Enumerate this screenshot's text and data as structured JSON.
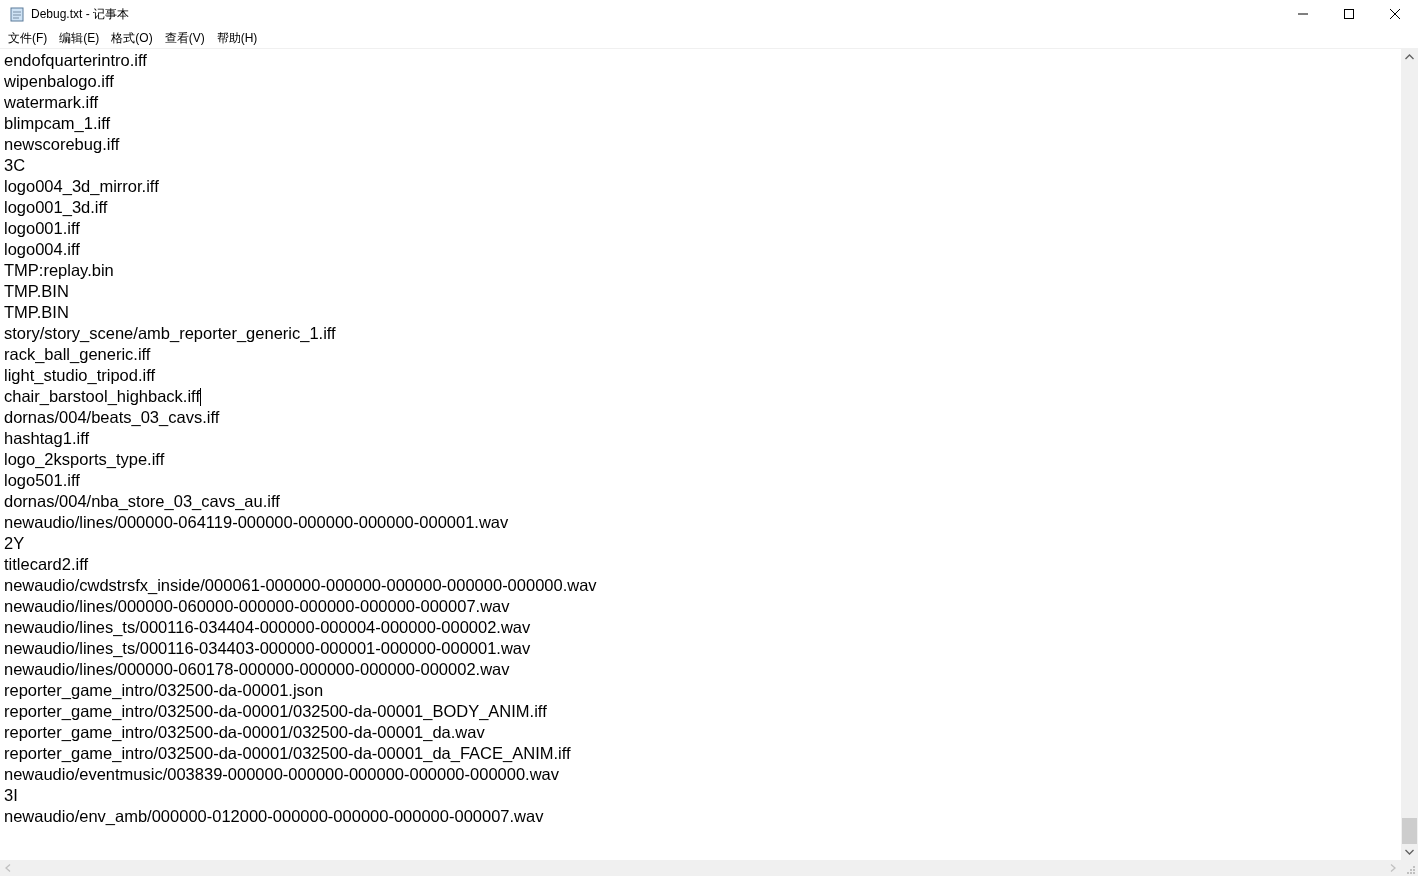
{
  "window": {
    "title": "Debug.txt - 记事本",
    "controls": [
      {
        "kind": "minimize"
      },
      {
        "kind": "maximize"
      },
      {
        "kind": "close"
      }
    ]
  },
  "menu": [
    {
      "label": "文件(F)"
    },
    {
      "label": "编辑(E)"
    },
    {
      "label": "格式(O)"
    },
    {
      "label": "查看(V)"
    },
    {
      "label": "帮助(H)"
    }
  ],
  "editor": {
    "lines": [
      {
        "text": "endofquarterintro.iff",
        "caret": false
      },
      {
        "text": "wipenbalogo.iff",
        "caret": false
      },
      {
        "text": "watermark.iff",
        "caret": false
      },
      {
        "text": "blimpcam_1.iff",
        "caret": false
      },
      {
        "text": "newscorebug.iff",
        "caret": false
      },
      {
        "text": "3C",
        "caret": false
      },
      {
        "text": "logo004_3d_mirror.iff",
        "caret": false
      },
      {
        "text": "logo001_3d.iff",
        "caret": false
      },
      {
        "text": "logo001.iff",
        "caret": false
      },
      {
        "text": "logo004.iff",
        "caret": false
      },
      {
        "text": "TMP:replay.bin",
        "caret": false
      },
      {
        "text": "TMP.BIN",
        "caret": false
      },
      {
        "text": "TMP.BIN",
        "caret": false
      },
      {
        "text": "story/story_scene/amb_reporter_generic_1.iff",
        "caret": false
      },
      {
        "text": "rack_ball_generic.iff",
        "caret": false
      },
      {
        "text": "light_studio_tripod.iff",
        "caret": false
      },
      {
        "text": "chair_barstool_highback.iff",
        "caret": true
      },
      {
        "text": "dornas/004/beats_03_cavs.iff",
        "caret": false
      },
      {
        "text": "hashtag1.iff",
        "caret": false
      },
      {
        "text": "logo_2ksports_type.iff",
        "caret": false
      },
      {
        "text": "logo501.iff",
        "caret": false
      },
      {
        "text": "dornas/004/nba_store_03_cavs_au.iff",
        "caret": false
      },
      {
        "text": "newaudio/lines/000000-064119-000000-000000-000000-000001.wav",
        "caret": false
      },
      {
        "text": "2Y",
        "caret": false
      },
      {
        "text": "titlecard2.iff",
        "caret": false
      },
      {
        "text": "newaudio/cwdstrsfx_inside/000061-000000-000000-000000-000000-000000.wav",
        "caret": false
      },
      {
        "text": "newaudio/lines/000000-060000-000000-000000-000000-000007.wav",
        "caret": false
      },
      {
        "text": "newaudio/lines_ts/000116-034404-000000-000004-000000-000002.wav",
        "caret": false
      },
      {
        "text": "newaudio/lines_ts/000116-034403-000000-000001-000000-000001.wav",
        "caret": false
      },
      {
        "text": "newaudio/lines/000000-060178-000000-000000-000000-000002.wav",
        "caret": false
      },
      {
        "text": "reporter_game_intro/032500-da-00001.json",
        "caret": false
      },
      {
        "text": "reporter_game_intro/032500-da-00001/032500-da-00001_BODY_ANIM.iff",
        "caret": false
      },
      {
        "text": "reporter_game_intro/032500-da-00001/032500-da-00001_da.wav",
        "caret": false
      },
      {
        "text": "reporter_game_intro/032500-da-00001/032500-da-00001_da_FACE_ANIM.iff",
        "caret": false
      },
      {
        "text": "newaudio/eventmusic/003839-000000-000000-000000-000000-000000.wav",
        "caret": false
      },
      {
        "text": "3I",
        "caret": false
      },
      {
        "text": "newaudio/env_amb/000000-012000-000000-000000-000000-000007.wav",
        "caret": false
      }
    ]
  }
}
